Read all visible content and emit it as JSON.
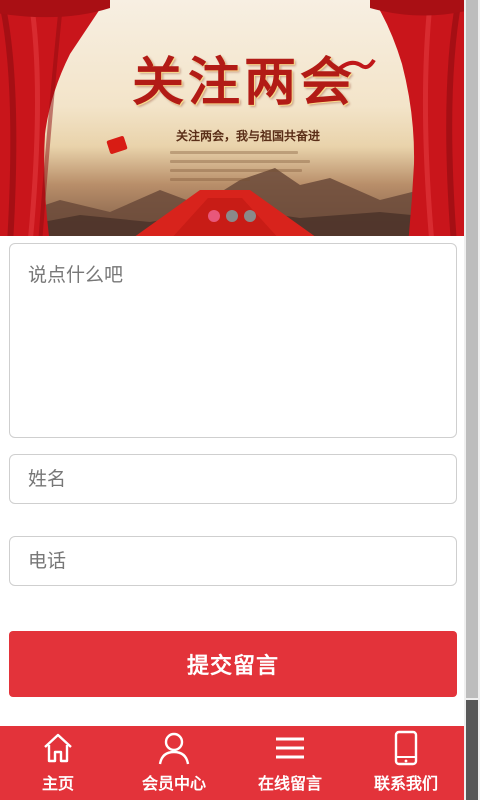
{
  "banner": {
    "title": "关注两会",
    "subtitle": "关注两会，我与祖国共奋进",
    "slides_total": 3,
    "active_slide": 1
  },
  "form": {
    "message_placeholder": "说点什么吧",
    "name_placeholder": "姓名",
    "phone_placeholder": "电话",
    "submit_label": "提交留言"
  },
  "nav": {
    "items": [
      {
        "label": "主页",
        "icon": "home-icon"
      },
      {
        "label": "会员中心",
        "icon": "user-icon"
      },
      {
        "label": "在线留言",
        "icon": "menu-icon"
      },
      {
        "label": "联系我们",
        "icon": "phone-icon"
      }
    ]
  },
  "colors": {
    "accent": "#e3333a",
    "banner_title": "#b21b16",
    "dot_active": "#e8577a",
    "dot_inactive": "#8a8a8a"
  }
}
